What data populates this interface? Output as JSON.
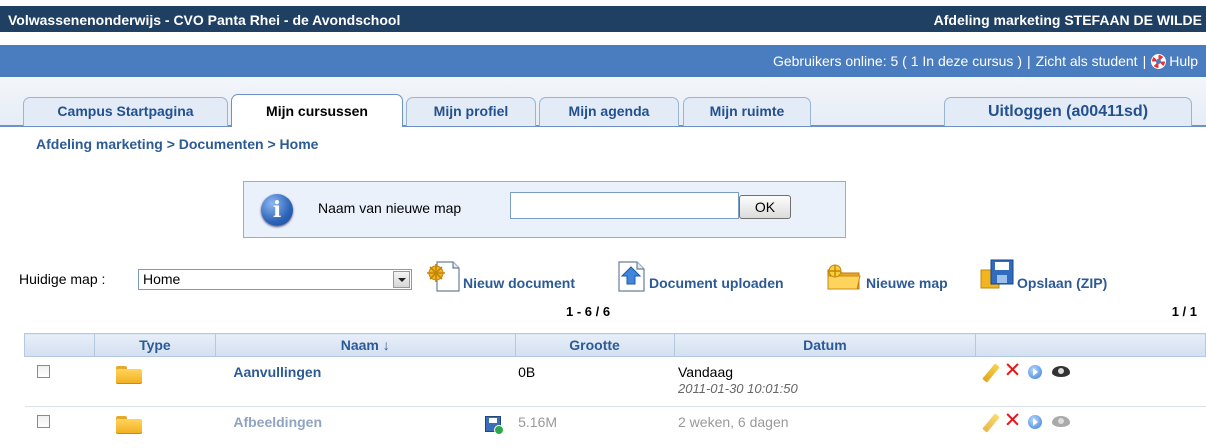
{
  "header": {
    "site_title": "Volwassenenonderwijs - CVO Panta Rhei - de Avondschool",
    "department_user": "Afdeling marketing STEFAAN DE WILDE"
  },
  "infobar": {
    "users_online": "Gebruikers online:  5  ( 1 In deze cursus  )",
    "view_as_student": "Zicht als student",
    "help": "Hulp"
  },
  "tabs": [
    {
      "label": "Campus Startpagina",
      "active": false
    },
    {
      "label": "Mijn cursussen",
      "active": true
    },
    {
      "label": "Mijn profiel",
      "active": false
    },
    {
      "label": "Mijn agenda",
      "active": false
    },
    {
      "label": "Mijn ruimte",
      "active": false
    }
  ],
  "logout_label": "Uitloggen (a00411sd)",
  "breadcrumb": {
    "part1": "Afdeling marketing",
    "part2": "Documenten",
    "part3": "Home",
    "separator": ">"
  },
  "new_folder": {
    "label": "Naam van nieuwe map",
    "value": "",
    "ok_label": "OK"
  },
  "current_folder": {
    "label": "Huidige map :",
    "selected": "Home"
  },
  "actions": {
    "new_document": "Nieuw document",
    "upload_document": "Document uploaden",
    "new_folder": "Nieuwe map",
    "save_zip": "Opslaan (ZIP)"
  },
  "pager": {
    "range": "1 - 6 / 6",
    "pages": "1 / 1"
  },
  "table": {
    "headers": {
      "type": "Type",
      "name": "Naam ↓",
      "size": "Grootte",
      "date": "Datum"
    },
    "rows": [
      {
        "name": "Aanvullingen",
        "size": "0B",
        "date": "Vandaag",
        "timestamp": "2011-01-30 10:01:50",
        "hidden": false
      },
      {
        "name": "Afbeeldingen",
        "size": "5.16M",
        "date": "2 weken, 6 dagen",
        "timestamp": "",
        "hidden": true
      }
    ]
  },
  "colors": {
    "header_dark": "#1f3f63",
    "header_blue": "#4a7cc0",
    "link_blue": "#2c5a96",
    "delete_red": "#e01a1a"
  }
}
